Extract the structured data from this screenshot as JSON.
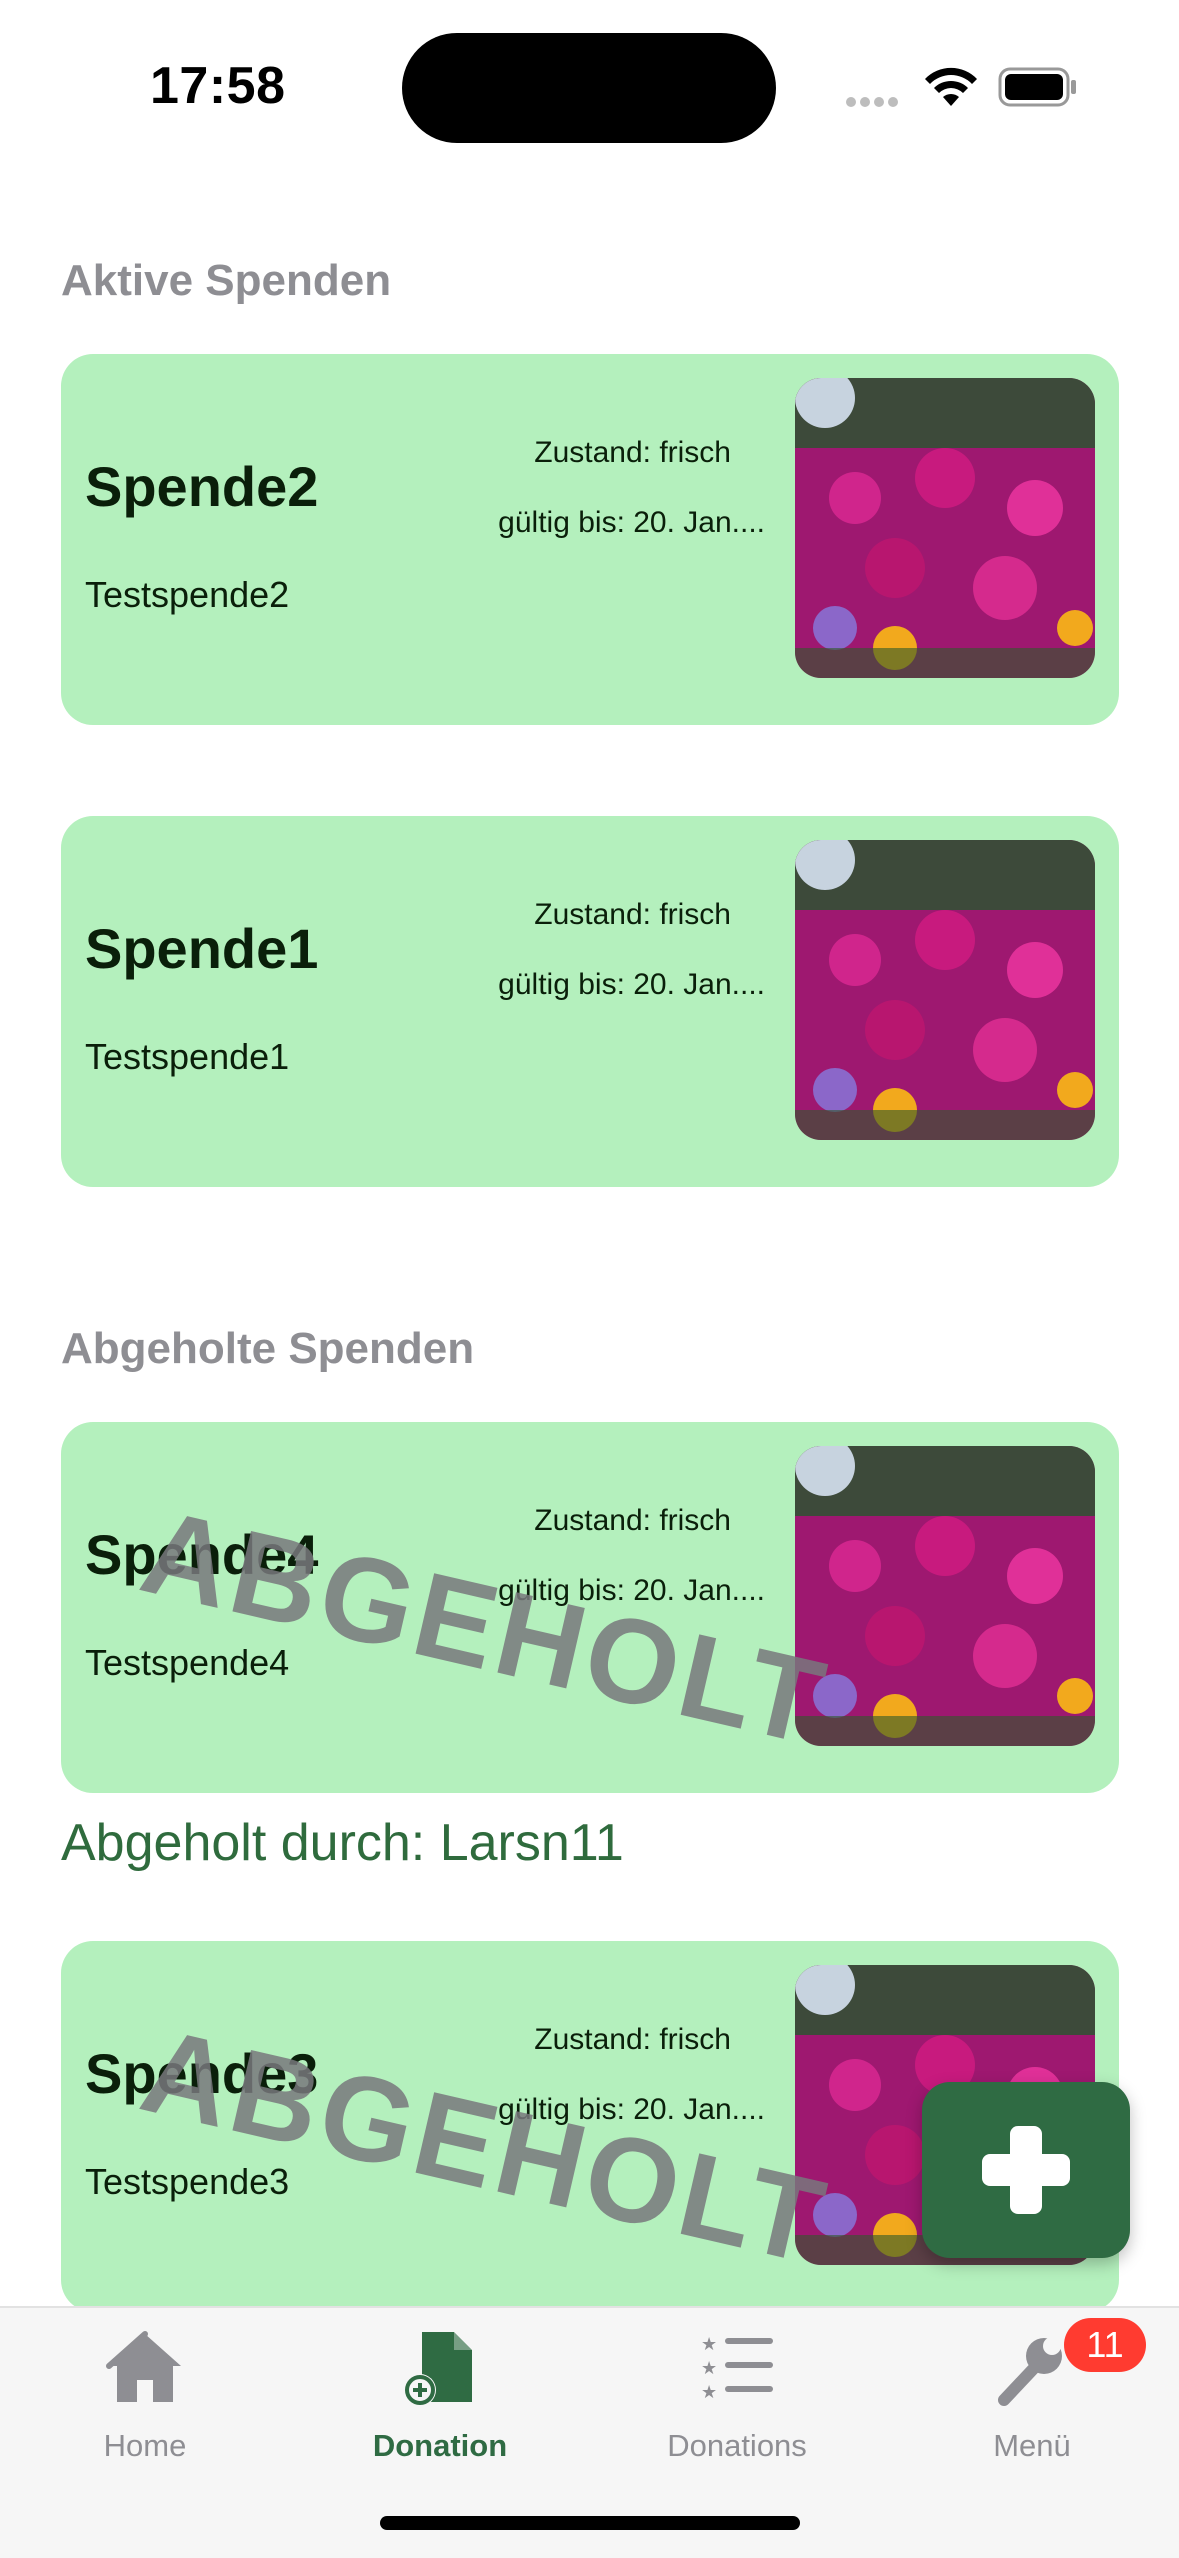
{
  "status_bar": {
    "time": "17:58"
  },
  "sections": {
    "active": {
      "title": "Aktive Spenden",
      "cards": [
        {
          "title": "Spende2",
          "description": "Testspende2",
          "state": "Zustand: frisch",
          "valid_until": "gültig bis: 20. Jan...."
        },
        {
          "title": "Spende1",
          "description": "Testspende1",
          "state": "Zustand: frisch",
          "valid_until": "gültig bis: 20. Jan...."
        }
      ]
    },
    "picked_up": {
      "title": "Abgeholte Spenden",
      "stamp": "ABGEHOLT",
      "cards": [
        {
          "title": "Spende4",
          "description": "Testspende4",
          "state": "Zustand: frisch",
          "valid_until": "gültig bis: 20. Jan....",
          "picked_by": "Abgeholt durch: Larsn11"
        },
        {
          "title": "Spende3",
          "description": "Testspende3",
          "state": "Zustand: frisch",
          "valid_until": "gültig bis: 20. Jan...."
        }
      ]
    }
  },
  "fab": {
    "icon": "plus-icon"
  },
  "tabbar": {
    "tabs": [
      {
        "label": "Home",
        "icon": "house-icon",
        "active": false
      },
      {
        "label": "Donation",
        "icon": "document-add-icon",
        "active": true
      },
      {
        "label": "Donations",
        "icon": "list-icon",
        "active": false
      },
      {
        "label": "Menü",
        "icon": "wrench-icon",
        "active": false,
        "badge": "11"
      }
    ]
  },
  "colors": {
    "card_background": "#b4f0bd",
    "accent": "#2f6b43",
    "badge": "#ff3b30",
    "section_header": "#8e8e93"
  }
}
